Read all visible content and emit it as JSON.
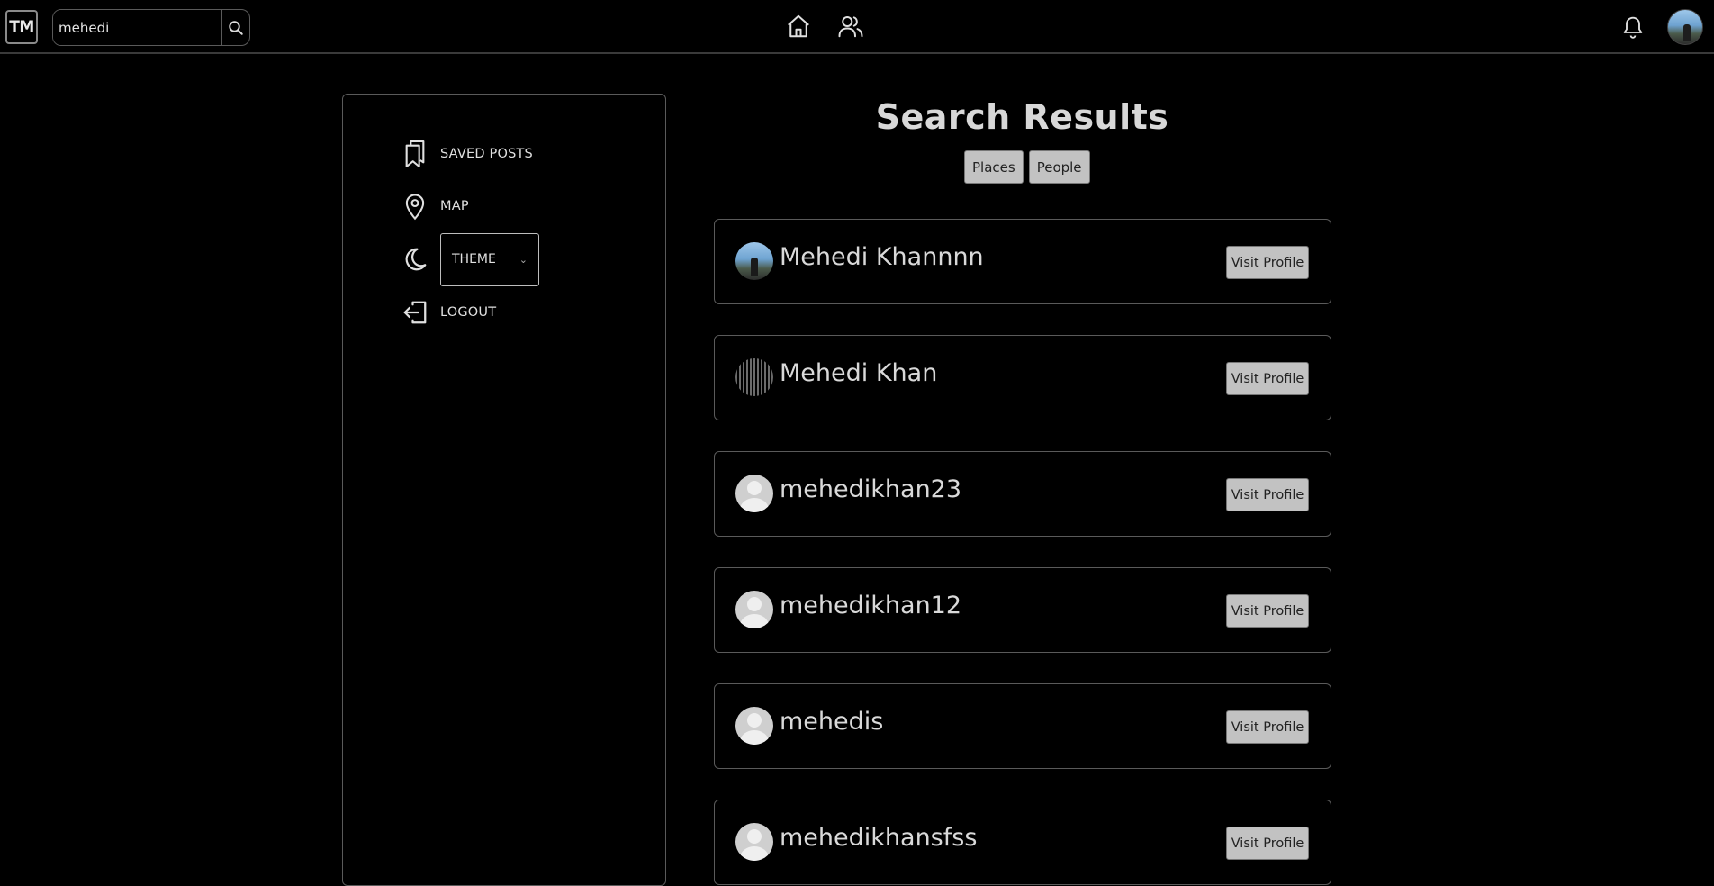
{
  "header": {
    "logo_text": "TM",
    "search_value": "mehedi",
    "search_icon": "search-icon",
    "nav_icons": [
      "home-icon",
      "people-icon"
    ],
    "notification_icon": "bell-icon"
  },
  "sidebar": {
    "items": [
      {
        "label": "SAVED POSTS",
        "icon": "bookmark-icon"
      },
      {
        "label": "MAP",
        "icon": "map-pin-icon"
      },
      {
        "label": "THEME",
        "icon": "moon-icon"
      },
      {
        "label": "LOGOUT",
        "icon": "logout-icon"
      }
    ]
  },
  "main": {
    "title": "Search Results",
    "tabs": [
      {
        "label": "Places"
      },
      {
        "label": "People"
      }
    ],
    "results": [
      {
        "name": "Mehedi Khannnn",
        "avatar": "photo",
        "action": "Visit Profile"
      },
      {
        "name": "Mehedi Khan",
        "avatar": "broken-image",
        "action": "Visit Profile"
      },
      {
        "name": "mehedikhan23",
        "avatar": "default",
        "action": "Visit Profile"
      },
      {
        "name": "mehedikhan12",
        "avatar": "default",
        "action": "Visit Profile"
      },
      {
        "name": "mehedis",
        "avatar": "default",
        "action": "Visit Profile"
      },
      {
        "name": "mehedikhansfss",
        "avatar": "default",
        "action": "Visit Profile"
      }
    ]
  },
  "colors": {
    "background": "#000000",
    "text": "#d9d9d9",
    "button_bg": "#c2c2c2",
    "border": "#5a5a5a"
  }
}
